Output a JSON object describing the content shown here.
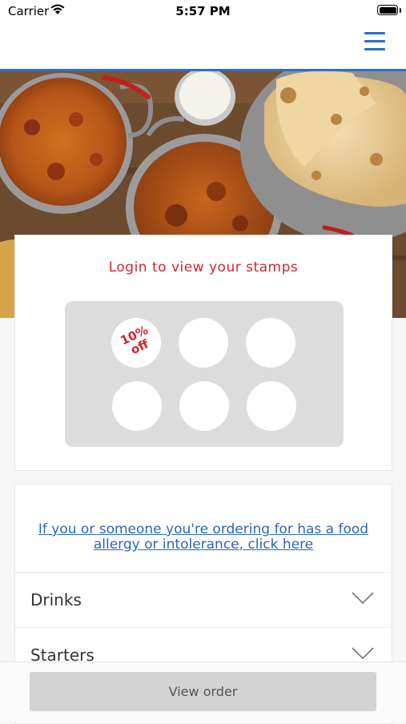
{
  "status_bar": {
    "carrier": "Carrier",
    "time": "5:57 PM",
    "battery_level": 1.0
  },
  "nav": {
    "menu_icon": "hamburger-menu-icon",
    "accent_color": "#2f6fc4"
  },
  "hero": {
    "image": "food-banner-image"
  },
  "stamps": {
    "title": "Login to view your stamps",
    "title_color": "#d1262f",
    "reward_label": "10% off",
    "slots": 6
  },
  "menu": {
    "allergy_link": "If you or someone you're ordering for has a food allergy or intolerance, click here",
    "sections": [
      {
        "label": "Drinks"
      },
      {
        "label": "Starters"
      }
    ]
  },
  "footer": {
    "view_order_label": "View order"
  }
}
